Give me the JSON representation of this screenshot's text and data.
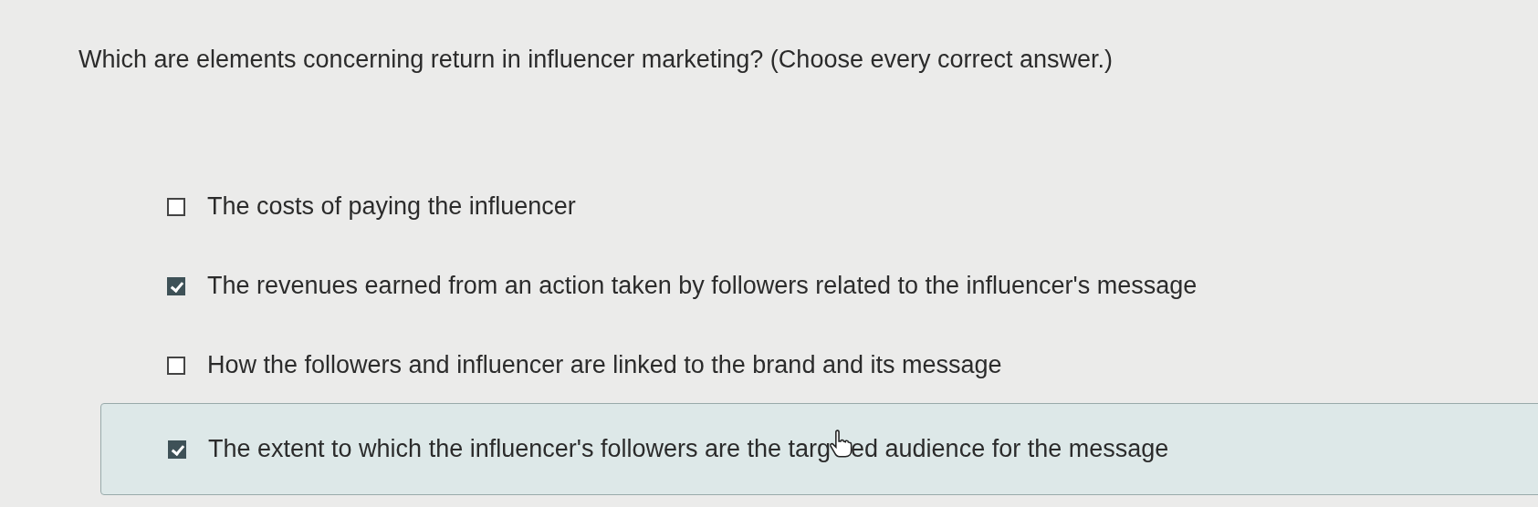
{
  "question": "Which are elements concerning return in influencer marketing? (Choose every correct answer.)",
  "options": [
    {
      "text": "The costs of paying the influencer",
      "checked": false,
      "selected": false
    },
    {
      "text": "The revenues earned from an action taken by followers related to the influencer's message",
      "checked": true,
      "selected": false
    },
    {
      "text": "How the followers and influencer are linked to the brand and its message",
      "checked": false,
      "selected": false
    },
    {
      "text": "The extent to which the influencer's followers are the targ",
      "text_after_cursor": "ed audience for the message",
      "checked": true,
      "selected": true
    }
  ]
}
